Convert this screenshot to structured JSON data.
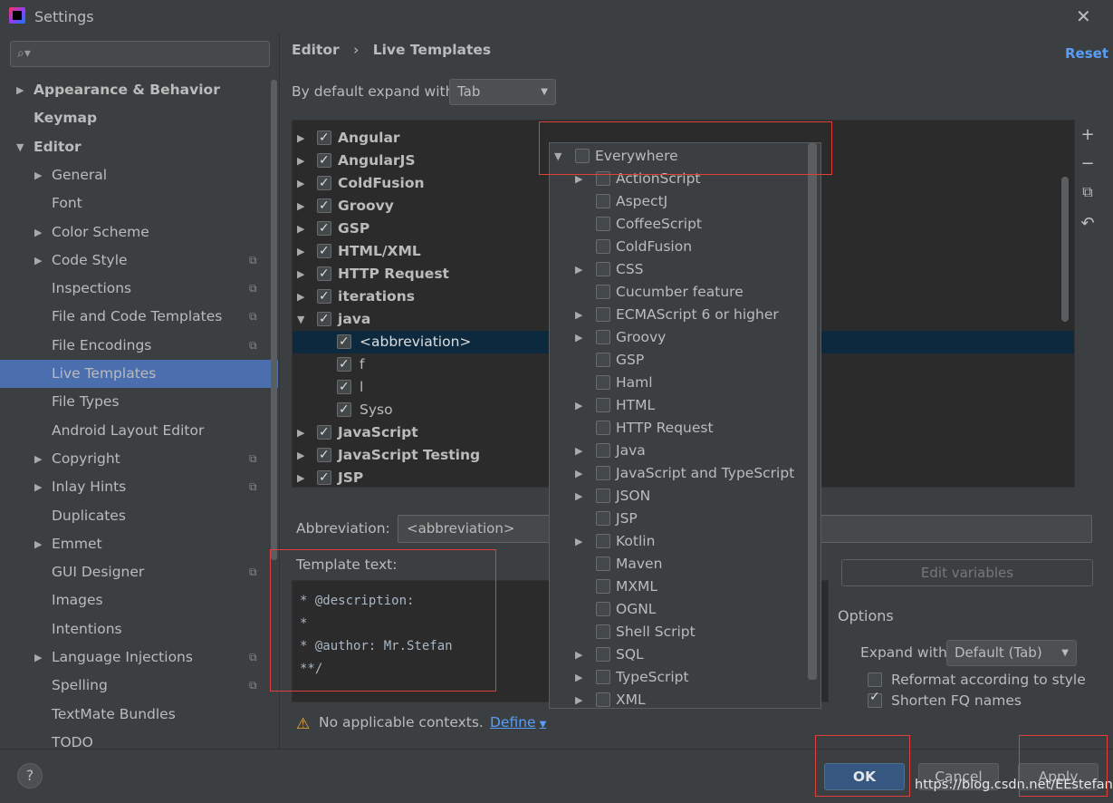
{
  "window": {
    "title": "Settings"
  },
  "sidebar": {
    "search_placeholder": "",
    "items": [
      {
        "label": "Appearance & Behavior",
        "bold": true,
        "arrow": "▶",
        "indent": 0,
        "selected": false,
        "cfg": false
      },
      {
        "label": "Keymap",
        "bold": true,
        "arrow": "",
        "indent": 0,
        "selected": false,
        "cfg": false
      },
      {
        "label": "Editor",
        "bold": true,
        "arrow": "▼",
        "indent": 0,
        "selected": false,
        "cfg": false
      },
      {
        "label": "General",
        "bold": false,
        "arrow": "▶",
        "indent": 1,
        "selected": false,
        "cfg": false
      },
      {
        "label": "Font",
        "bold": false,
        "arrow": "",
        "indent": 1,
        "selected": false,
        "cfg": false
      },
      {
        "label": "Color Scheme",
        "bold": false,
        "arrow": "▶",
        "indent": 1,
        "selected": false,
        "cfg": false
      },
      {
        "label": "Code Style",
        "bold": false,
        "arrow": "▶",
        "indent": 1,
        "selected": false,
        "cfg": true
      },
      {
        "label": "Inspections",
        "bold": false,
        "arrow": "",
        "indent": 1,
        "selected": false,
        "cfg": true
      },
      {
        "label": "File and Code Templates",
        "bold": false,
        "arrow": "",
        "indent": 1,
        "selected": false,
        "cfg": true
      },
      {
        "label": "File Encodings",
        "bold": false,
        "arrow": "",
        "indent": 1,
        "selected": false,
        "cfg": true
      },
      {
        "label": "Live Templates",
        "bold": false,
        "arrow": "",
        "indent": 1,
        "selected": true,
        "cfg": false
      },
      {
        "label": "File Types",
        "bold": false,
        "arrow": "",
        "indent": 1,
        "selected": false,
        "cfg": false
      },
      {
        "label": "Android Layout Editor",
        "bold": false,
        "arrow": "",
        "indent": 1,
        "selected": false,
        "cfg": false
      },
      {
        "label": "Copyright",
        "bold": false,
        "arrow": "▶",
        "indent": 1,
        "selected": false,
        "cfg": true
      },
      {
        "label": "Inlay Hints",
        "bold": false,
        "arrow": "▶",
        "indent": 1,
        "selected": false,
        "cfg": true
      },
      {
        "label": "Duplicates",
        "bold": false,
        "arrow": "",
        "indent": 1,
        "selected": false,
        "cfg": false
      },
      {
        "label": "Emmet",
        "bold": false,
        "arrow": "▶",
        "indent": 1,
        "selected": false,
        "cfg": false
      },
      {
        "label": "GUI Designer",
        "bold": false,
        "arrow": "",
        "indent": 1,
        "selected": false,
        "cfg": true
      },
      {
        "label": "Images",
        "bold": false,
        "arrow": "",
        "indent": 1,
        "selected": false,
        "cfg": false
      },
      {
        "label": "Intentions",
        "bold": false,
        "arrow": "",
        "indent": 1,
        "selected": false,
        "cfg": false
      },
      {
        "label": "Language Injections",
        "bold": false,
        "arrow": "▶",
        "indent": 1,
        "selected": false,
        "cfg": true
      },
      {
        "label": "Spelling",
        "bold": false,
        "arrow": "",
        "indent": 1,
        "selected": false,
        "cfg": true
      },
      {
        "label": "TextMate Bundles",
        "bold": false,
        "arrow": "",
        "indent": 1,
        "selected": false,
        "cfg": false
      },
      {
        "label": "TODO",
        "bold": false,
        "arrow": "",
        "indent": 1,
        "selected": false,
        "cfg": false
      }
    ]
  },
  "header": {
    "breadcrumb_parent": "Editor",
    "breadcrumb_sep": "›",
    "breadcrumb_current": "Live Templates",
    "reset_label": "Reset",
    "expand_label": "By default expand with",
    "expand_value": "Tab"
  },
  "templates_tree": [
    {
      "label": "Angular",
      "group": true,
      "checked": true,
      "expanded": false
    },
    {
      "label": "AngularJS",
      "group": true,
      "checked": true,
      "expanded": false
    },
    {
      "label": "ColdFusion",
      "group": true,
      "checked": true,
      "expanded": false
    },
    {
      "label": "Groovy",
      "group": true,
      "checked": true,
      "expanded": false
    },
    {
      "label": "GSP",
      "group": true,
      "checked": true,
      "expanded": false
    },
    {
      "label": "HTML/XML",
      "group": true,
      "checked": true,
      "expanded": false
    },
    {
      "label": "HTTP Request",
      "group": true,
      "checked": true,
      "expanded": false
    },
    {
      "label": "iterations",
      "group": true,
      "checked": true,
      "expanded": false
    },
    {
      "label": "java",
      "group": true,
      "checked": true,
      "expanded": true
    },
    {
      "label": "<abbreviation>",
      "group": false,
      "checked": true,
      "selected": true
    },
    {
      "label": "f",
      "group": false,
      "checked": true
    },
    {
      "label": "l",
      "group": false,
      "checked": true
    },
    {
      "label": "Syso",
      "group": false,
      "checked": true
    },
    {
      "label": "JavaScript",
      "group": true,
      "checked": true,
      "expanded": false
    },
    {
      "label": "JavaScript Testing",
      "group": true,
      "checked": true,
      "expanded": false
    },
    {
      "label": "JSP",
      "group": true,
      "checked": true,
      "expanded": false
    }
  ],
  "toolbar_icons": [
    {
      "name": "add-icon",
      "glyph": "+"
    },
    {
      "name": "remove-icon",
      "glyph": "−"
    },
    {
      "name": "copy-icon",
      "glyph": "⧉"
    },
    {
      "name": "restore-icon",
      "glyph": "↶"
    }
  ],
  "editor": {
    "abbreviation_label": "Abbreviation:",
    "abbreviation_value": "<abbreviation>",
    "template_text_label": "Template text:",
    "template_lines": [
      "* @description:",
      "*",
      "* @author: Mr.Stefan",
      "**/"
    ],
    "edit_variables_label": "Edit variables",
    "options_label": "Options",
    "expand_with_label": "Expand with",
    "expand_with_value": "Default (Tab)",
    "reformat_label": "Reformat according to style",
    "reformat_checked": false,
    "shorten_label": "Shorten FQ names",
    "shorten_checked": true,
    "warning_text": "No applicable contexts.",
    "define_label": "Define"
  },
  "context_popup": [
    {
      "label": "Everywhere",
      "arrow": "▼",
      "level": 0
    },
    {
      "label": "ActionScript",
      "arrow": "▶",
      "level": 1
    },
    {
      "label": "AspectJ",
      "arrow": "",
      "level": 1
    },
    {
      "label": "CoffeeScript",
      "arrow": "",
      "level": 1
    },
    {
      "label": "ColdFusion",
      "arrow": "",
      "level": 1
    },
    {
      "label": "CSS",
      "arrow": "▶",
      "level": 1
    },
    {
      "label": "Cucumber feature",
      "arrow": "",
      "level": 1
    },
    {
      "label": "ECMAScript 6 or higher",
      "arrow": "▶",
      "level": 1
    },
    {
      "label": "Groovy",
      "arrow": "▶",
      "level": 1
    },
    {
      "label": "GSP",
      "arrow": "",
      "level": 1
    },
    {
      "label": "Haml",
      "arrow": "",
      "level": 1
    },
    {
      "label": "HTML",
      "arrow": "▶",
      "level": 1
    },
    {
      "label": "HTTP Request",
      "arrow": "",
      "level": 1
    },
    {
      "label": "Java",
      "arrow": "▶",
      "level": 1
    },
    {
      "label": "JavaScript and TypeScript",
      "arrow": "▶",
      "level": 1
    },
    {
      "label": "JSON",
      "arrow": "▶",
      "level": 1
    },
    {
      "label": "JSP",
      "arrow": "",
      "level": 1
    },
    {
      "label": "Kotlin",
      "arrow": "▶",
      "level": 1
    },
    {
      "label": "Maven",
      "arrow": "",
      "level": 1
    },
    {
      "label": "MXML",
      "arrow": "",
      "level": 1
    },
    {
      "label": "OGNL",
      "arrow": "",
      "level": 1
    },
    {
      "label": "Shell Script",
      "arrow": "",
      "level": 1
    },
    {
      "label": "SQL",
      "arrow": "▶",
      "level": 1
    },
    {
      "label": "TypeScript",
      "arrow": "▶",
      "level": 1
    },
    {
      "label": "XML",
      "arrow": "▶",
      "level": 1
    }
  ],
  "footer": {
    "help_label": "?",
    "ok_label": "OK",
    "cancel_label": "Cancel",
    "apply_label": "Apply",
    "watermark": "https://blog.csdn.net/EEstefan"
  },
  "colors": {
    "background": "#3c3f41",
    "selection": "#4b6eaf",
    "tree_selection": "#0d293e",
    "accent_link": "#589df6",
    "annotation_box": "#e0403a"
  }
}
